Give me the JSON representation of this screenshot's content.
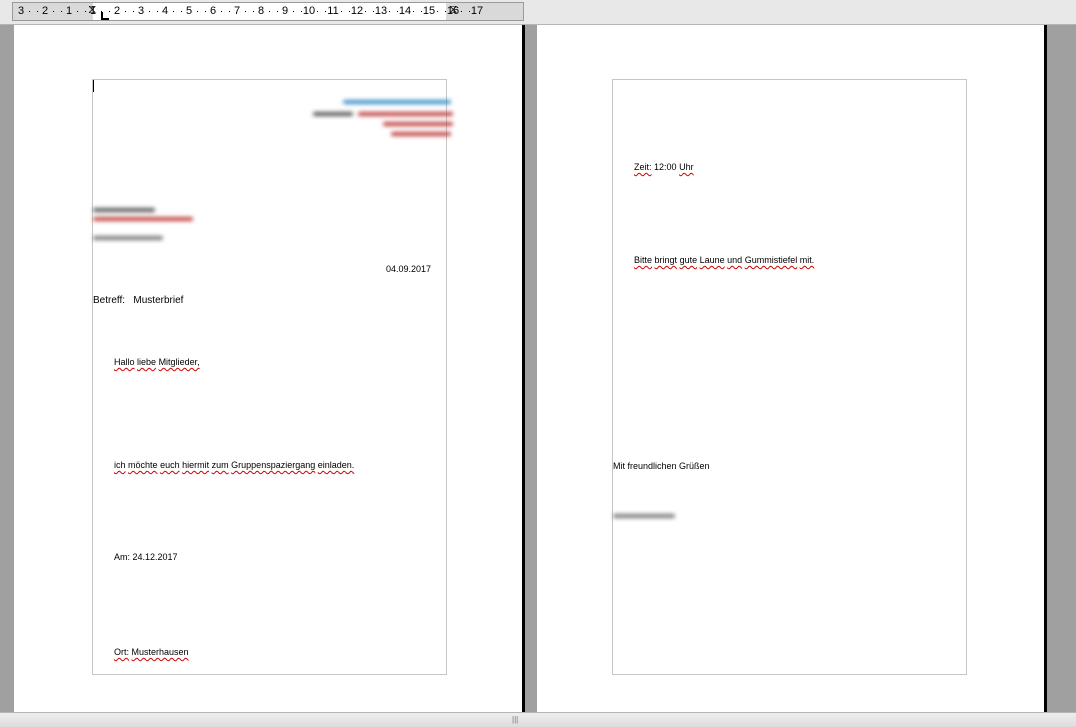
{
  "ruler": {
    "numbers": [
      "3",
      "2",
      "1",
      "1",
      "2",
      "3",
      "4",
      "5",
      "6",
      "7",
      "8",
      "9",
      "10",
      "11",
      "12",
      "13",
      "14",
      "15",
      "16",
      "17"
    ]
  },
  "page1": {
    "sender_blurred": [
      "Mustermann Verein",
      "Musterstraße 1 · 12345 Musterstadt"
    ],
    "recipient_blurred": [
      "Musterfrau Maria",
      "Musterweg 12",
      "12345 Musterort"
    ],
    "date": "04.09.2017",
    "subject_label": "Betreff:",
    "subject_value": "Musterbrief",
    "greeting": [
      "Hallo",
      "liebe",
      "Mitglieder,"
    ],
    "invite": [
      "ich",
      "möchte",
      "euch",
      "hiermit",
      "zum",
      "Gruppenspaziergang",
      "einladen."
    ],
    "date_line": "Am: 24.12.2017",
    "place_label": "Ort:",
    "place_value": "Musterhausen"
  },
  "page2": {
    "time_label": "Zeit:",
    "time_value": "12:00",
    "time_unit": "Uhr",
    "bring": [
      "Bitte",
      "bringt",
      "gute",
      "Laune",
      "und",
      "Gummistiefel",
      "mit."
    ],
    "closing": "Mit freundlichen Grüßen",
    "signature_blurred": "Vorname Name"
  },
  "colors": {
    "spellcheck_underline": "#cc0000",
    "page_background": "#ffffff",
    "workspace_background": "#a0a0a0",
    "blur_accent_blue": "#3a8fc8",
    "blur_accent_red": "#c04040"
  }
}
